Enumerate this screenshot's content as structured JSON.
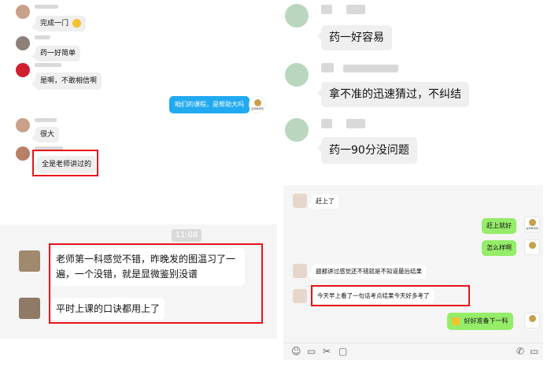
{
  "panel_a": {
    "messages": [
      {
        "text": "完成一门",
        "emoji": "smile-emoji"
      },
      {
        "text": "药一好简单"
      },
      {
        "text": "是啊，不敢相信啊"
      },
      {
        "text": "咱们的课程，是帮助大吗",
        "outgoing": true
      },
      {
        "text": "很大"
      },
      {
        "text": "全是老师讲过的"
      }
    ],
    "brand_logo_text": "医学教育网"
  },
  "panel_b": {
    "messages": [
      {
        "text": "药一好容易"
      },
      {
        "text": "拿不准的迅速猜过，不纠结"
      },
      {
        "text": "药一90分没问题"
      }
    ]
  },
  "panel_c": {
    "timestamp": "11:08",
    "messages": [
      {
        "line1": "老师第一科感觉不错，昨晚发的图温习了一",
        "line2": "遍，一个没错，就是显微鉴别没谱"
      },
      {
        "text": "平时上课的口诀都用上了"
      }
    ]
  },
  "panel_d": {
    "messages": [
      {
        "text": "赶上了"
      },
      {
        "text": "赶上就好",
        "outgoing": true
      },
      {
        "text": "怎么样啊",
        "outgoing": true
      },
      {
        "text": "题都讲过感觉还不错就是不知道最后结果"
      },
      {
        "text": "今天早上看了一句话考点结果今天好多考了"
      },
      {
        "text": "好好准备下一科",
        "outgoing": true,
        "emoji": "thumbs-up"
      }
    ],
    "brand_logo_text": "医学教育网"
  },
  "colors": {
    "highlight": "#e8131b",
    "outgoing_green": "#95ec69",
    "outgoing_blue": "#22aaf0"
  }
}
